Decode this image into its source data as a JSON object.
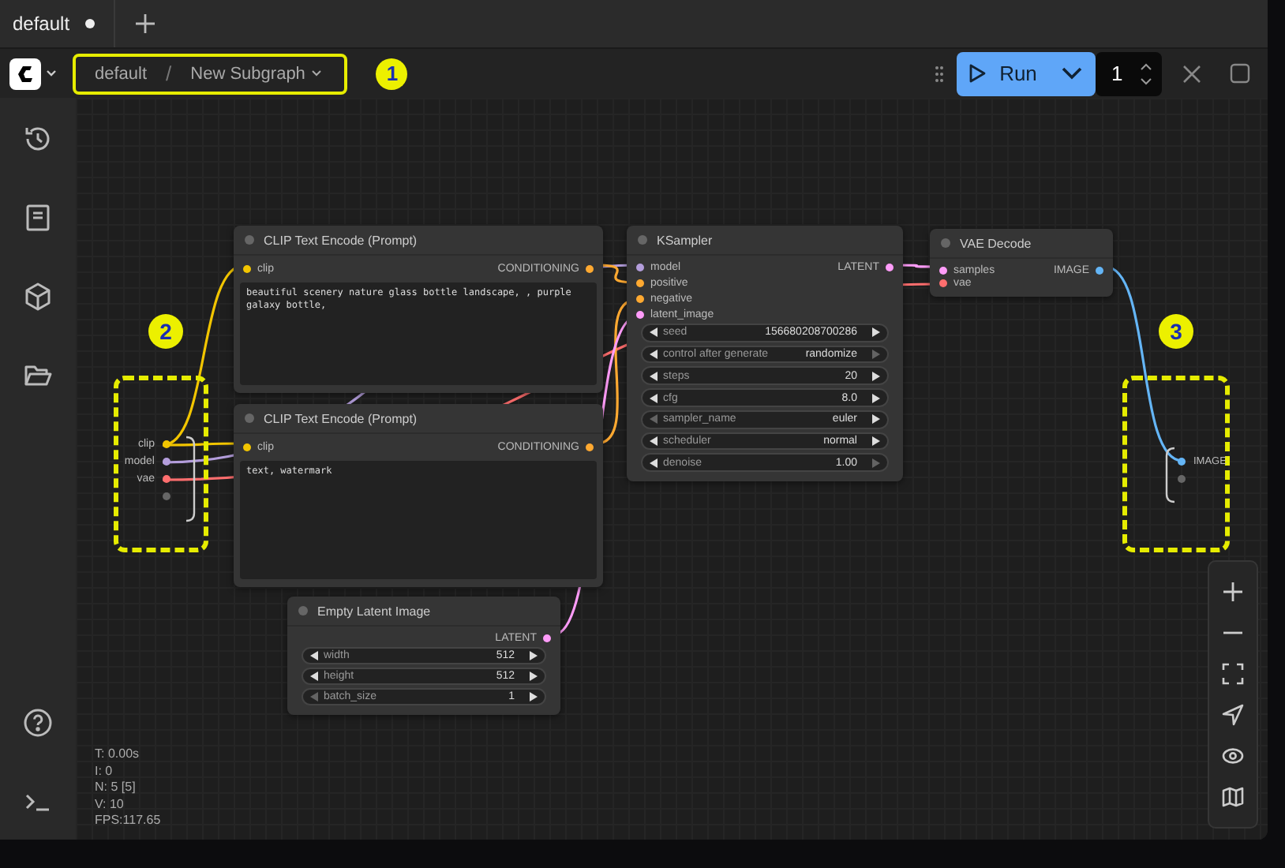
{
  "tabs": [
    {
      "label": "default",
      "modified": true
    }
  ],
  "breadcrumb": {
    "items": [
      "default",
      "New Subgraph"
    ],
    "separator": "/"
  },
  "run": {
    "label": "Run",
    "count": "1"
  },
  "annotations": [
    "1",
    "2",
    "3"
  ],
  "subgraph_inputs": [
    {
      "name": "clip",
      "color": "#f2c500"
    },
    {
      "name": "model",
      "color": "#b39ddb"
    },
    {
      "name": "vae",
      "color": "#ff6e6e"
    }
  ],
  "subgraph_outputs": [
    {
      "name": "IMAGE",
      "color": "#64b5f6"
    }
  ],
  "nodes": [
    {
      "title": "CLIP Text Encode (Prompt)",
      "inputs": [
        {
          "name": "clip",
          "color": "#f2c500"
        }
      ],
      "outputs": [
        {
          "name": "CONDITIONING",
          "color": "#ffa931"
        }
      ],
      "text": "beautiful scenery nature glass bottle landscape, , purple galaxy bottle,"
    },
    {
      "title": "CLIP Text Encode (Prompt)",
      "inputs": [
        {
          "name": "clip",
          "color": "#f2c500"
        }
      ],
      "outputs": [
        {
          "name": "CONDITIONING",
          "color": "#ffa931"
        }
      ],
      "text": "text, watermark"
    },
    {
      "title": "KSampler",
      "inputs": [
        {
          "name": "model",
          "color": "#b39ddb"
        },
        {
          "name": "positive",
          "color": "#ffa931"
        },
        {
          "name": "negative",
          "color": "#ffa931"
        },
        {
          "name": "latent_image",
          "color": "#ff9cf9"
        }
      ],
      "outputs": [
        {
          "name": "LATENT",
          "color": "#ff9cf9"
        }
      ],
      "widgets": [
        {
          "name": "seed",
          "value": "156680208700286",
          "can_decrease": true,
          "can_increase": true
        },
        {
          "name": "control after generate",
          "value": "randomize",
          "can_decrease": true,
          "can_increase": false
        },
        {
          "name": "steps",
          "value": "20",
          "can_decrease": true,
          "can_increase": true
        },
        {
          "name": "cfg",
          "value": "8.0",
          "can_decrease": true,
          "can_increase": true
        },
        {
          "name": "sampler_name",
          "value": "euler",
          "can_decrease": false,
          "can_increase": true
        },
        {
          "name": "scheduler",
          "value": "normal",
          "can_decrease": true,
          "can_increase": true
        },
        {
          "name": "denoise",
          "value": "1.00",
          "can_decrease": true,
          "can_increase": false
        }
      ]
    },
    {
      "title": "VAE Decode",
      "inputs": [
        {
          "name": "samples",
          "color": "#ff9cf9"
        },
        {
          "name": "vae",
          "color": "#ff6e6e"
        }
      ],
      "outputs": [
        {
          "name": "IMAGE",
          "color": "#64b5f6"
        }
      ]
    },
    {
      "title": "Empty Latent Image",
      "outputs": [
        {
          "name": "LATENT",
          "color": "#ff9cf9"
        }
      ],
      "widgets": [
        {
          "name": "width",
          "value": "512",
          "can_decrease": true,
          "can_increase": true
        },
        {
          "name": "height",
          "value": "512",
          "can_decrease": true,
          "can_increase": true
        },
        {
          "name": "batch_size",
          "value": "1",
          "can_decrease": false,
          "can_increase": true
        }
      ]
    }
  ],
  "stats": [
    "T: 0.00s",
    "I: 0",
    "N: 5 [5]",
    "V: 10",
    "FPS:117.65"
  ]
}
